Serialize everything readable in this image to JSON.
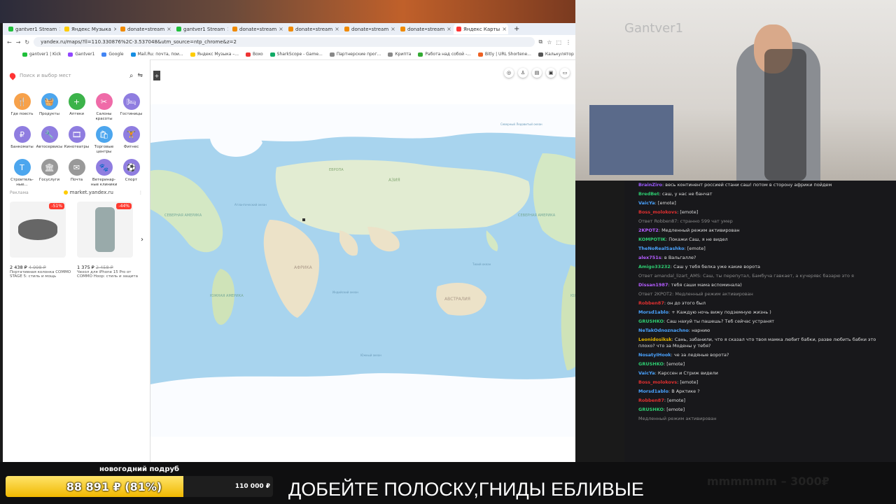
{
  "browser": {
    "tabs": [
      {
        "label": "gantver1 Stream",
        "color": "#1fbf3a"
      },
      {
        "label": "Яндекс Музыка",
        "color": "#ffcc00"
      },
      {
        "label": "donate•stream",
        "color": "#f08a00"
      },
      {
        "label": "gantver1 Stream",
        "color": "#1fbf3a"
      },
      {
        "label": "donate•stream",
        "color": "#f08a00"
      },
      {
        "label": "donate•stream",
        "color": "#f08a00"
      },
      {
        "label": "donate•stream",
        "color": "#f08a00"
      },
      {
        "label": "donate•stream",
        "color": "#f08a00"
      },
      {
        "label": "Яндекс Карты",
        "color": "#ff3333"
      }
    ],
    "url": "yandex.ru/maps/?ll=110.330876%2C-3.537048&utm_source=ntp_chrome&z=2",
    "bookmarks": [
      {
        "label": "gantver1 | Kick",
        "color": "#1fbf3a"
      },
      {
        "label": "Gantver1",
        "color": "#9146ff"
      },
      {
        "label": "Google",
        "color": "#4285f4"
      },
      {
        "label": "Mail.Ru: почта, пои...",
        "color": "#168de2"
      },
      {
        "label": "Яндекс Музыка –...",
        "color": "#ffcc00"
      },
      {
        "label": "Boxo",
        "color": "#e33"
      },
      {
        "label": "SharkScope - Game...",
        "color": "#1a6"
      },
      {
        "label": "Партнерские прог...",
        "color": "#888"
      },
      {
        "label": "Крипта",
        "color": "#888"
      },
      {
        "label": "Работа над собой -...",
        "color": "#3a3"
      },
      {
        "label": "Bitly | URL Shortene...",
        "color": "#ee6123"
      },
      {
        "label": "Калькулятор казор...",
        "color": "#555"
      }
    ]
  },
  "maps": {
    "search_placeholder": "Поиск и выбор мест",
    "categories": [
      {
        "label": "Где поесть",
        "icon": "fork-icon",
        "glyph": "🍴",
        "color": "#f7a14a"
      },
      {
        "label": "Продукты",
        "icon": "basket-icon",
        "glyph": "🧺",
        "color": "#4ca6ee"
      },
      {
        "label": "Аптеки",
        "icon": "pharmacy-icon",
        "glyph": "+",
        "color": "#3cb34a"
      },
      {
        "label": "Салоны красоты",
        "icon": "scissors-icon",
        "glyph": "✂",
        "color": "#ef6ba8"
      },
      {
        "label": "Гостиницы",
        "icon": "bed-icon",
        "glyph": "🛏",
        "color": "#8f7de0"
      },
      {
        "label": "Банкоматы",
        "icon": "ruble-icon",
        "glyph": "₽",
        "color": "#8f7de0"
      },
      {
        "label": "Автосервисы",
        "icon": "wrench-icon",
        "glyph": "🔧",
        "color": "#8f7de0"
      },
      {
        "label": "Кинотеатры",
        "icon": "film-icon",
        "glyph": "🎞",
        "color": "#8f7de0"
      },
      {
        "label": "Торговые центры",
        "icon": "bag-icon",
        "glyph": "🛍",
        "color": "#4ca6ee"
      },
      {
        "label": "Фитнес",
        "icon": "dumbbell-icon",
        "glyph": "🏋",
        "color": "#8f7de0"
      },
      {
        "label": "Строитель-ные...",
        "icon": "hammer-icon",
        "glyph": "T",
        "color": "#4ca6ee"
      },
      {
        "label": "Госуслуги",
        "icon": "building-icon",
        "glyph": "🏛",
        "color": "#999999"
      },
      {
        "label": "Почта",
        "icon": "mail-icon",
        "glyph": "✉",
        "color": "#999999"
      },
      {
        "label": "Ветеринар-ные клиники",
        "icon": "paw-icon",
        "glyph": "🐾",
        "color": "#8f7de0"
      },
      {
        "label": "Спорт",
        "icon": "sport-icon",
        "glyph": "⚽",
        "color": "#8f7de0"
      }
    ],
    "ad_label": "Реклама",
    "ad_source": "market.yandex.ru",
    "products": [
      {
        "discount": "-51%",
        "price": "2 438 ₽",
        "old_price": "4 998 ₽",
        "title": "Портативная колонка COMMO STAGE 5: стиль и мощь"
      },
      {
        "discount": "-44%",
        "price": "1 375 ₽",
        "old_price": "2 458 ₽",
        "title": "Чехол для iPhone 15 Pro от COMMO Hoop: стиль и защита"
      }
    ],
    "map_labels": {
      "north_america": "СЕВЕРНАЯ АМЕРИКА",
      "south_america": "ЮЖНАЯ АМЕРИКА",
      "africa": "АФРИКА",
      "asia": "АЗИЯ",
      "australia": "АВСТРАЛИЯ",
      "europe": "ЕВРОПА",
      "atlantic": "Атлантический океан",
      "pacific": "Тихий океан",
      "indian": "Индийский океан",
      "southern": "Южный океан",
      "arctic": "Северный Ледовитый океан"
    }
  },
  "chat": [
    {
      "user": "BrainZiro",
      "color": "#9b59ff",
      "text": "весь континент россией стани саш! потом в сторону африки пойдем"
    },
    {
      "user": "BredBet",
      "color": "#2ecc71",
      "text": "саш, у нас не банчат"
    },
    {
      "user": "VaicYa",
      "color": "#4aa3ff",
      "text": "[emote]"
    },
    {
      "user": "Boss_molokovs",
      "color": "#e03030",
      "text": "[emote]"
    },
    {
      "user": "",
      "color": "#888",
      "text": "Ответ Robben87: странно 599 чат умер"
    },
    {
      "user": "2KPOT2",
      "color": "#b45cff",
      "text": "Медленный режим активирован"
    },
    {
      "user": "KOMPOTIK",
      "color": "#2ecc71",
      "text": "Покажи Саш, я не видел"
    },
    {
      "user": "TheNoRealSashko",
      "color": "#4aa3ff",
      "text": "[emote]"
    },
    {
      "user": "alex751s",
      "color": "#b45cff",
      "text": "в Вальгалле?"
    },
    {
      "user": "Amigo33232",
      "color": "#2ecc71",
      "text": "Саш у тебя белка уже какие ворота"
    },
    {
      "user": "",
      "color": "#888",
      "text": "Ответ amandal_lizart_AMS: Саш, ты перепутал, Бамбуча гавкает, а кучерявс базарю это я"
    },
    {
      "user": "Dissan1987",
      "color": "#b45cff",
      "text": "тебя саши мама вспоминала)"
    },
    {
      "user": "",
      "color": "#888",
      "text": "Ответ 2KPOT2: Медленный режим активирован"
    },
    {
      "user": "Robben87",
      "color": "#e03030",
      "text": "он до этого был"
    },
    {
      "user": "Morsd1ablo",
      "color": "#4aa3ff",
      "text": "+ Каждую ночь вижу подземную жизнь )"
    },
    {
      "user": "GRUSHKO",
      "color": "#2ecc71",
      "text": "Саш нахуй ты пашешь? Теб сейчас устранят"
    },
    {
      "user": "NeTakOdnoznachno",
      "color": "#4aa3ff",
      "text": "нарнию"
    },
    {
      "user": "Leonidosiksk",
      "color": "#e6b800",
      "text": "Сань, забанили, что я сказал что твоя мамка любит бабки, разве любить бабки это плохо? что за Модены у тебя?"
    },
    {
      "user": "NosatyIHook",
      "color": "#4aa3ff",
      "text": "че за ледяные ворота?"
    },
    {
      "user": "GRUSHKO",
      "color": "#2ecc71",
      "text": "[emote]"
    },
    {
      "user": "VaicYa",
      "color": "#4aa3ff",
      "text": "Карссен и Стриж видели"
    },
    {
      "user": "Boss_molokovs",
      "color": "#e03030",
      "text": "[emote]"
    },
    {
      "user": "Morsd1ablo",
      "color": "#4aa3ff",
      "text": "В Арктике ?"
    },
    {
      "user": "Robben87",
      "color": "#e03030",
      "text": "[emote]"
    },
    {
      "user": "GRUSHKO",
      "color": "#2ecc71",
      "text": "[emote]"
    },
    {
      "user": "",
      "color": "#888",
      "text": "Медленный режим активирован"
    }
  ],
  "goal": {
    "title": "новогодний подруб",
    "amount": "88 891 ₽ (81%)",
    "target": "110 000 ₽",
    "progress": 0.81,
    "accent": "#f5c400"
  },
  "ticker": "ДОБЕЙТЕ ПОЛОСКУ,ГНИДЫ ЕБЛИВЫЕ",
  "ghost_text": "mmmmmm – 3000₽"
}
